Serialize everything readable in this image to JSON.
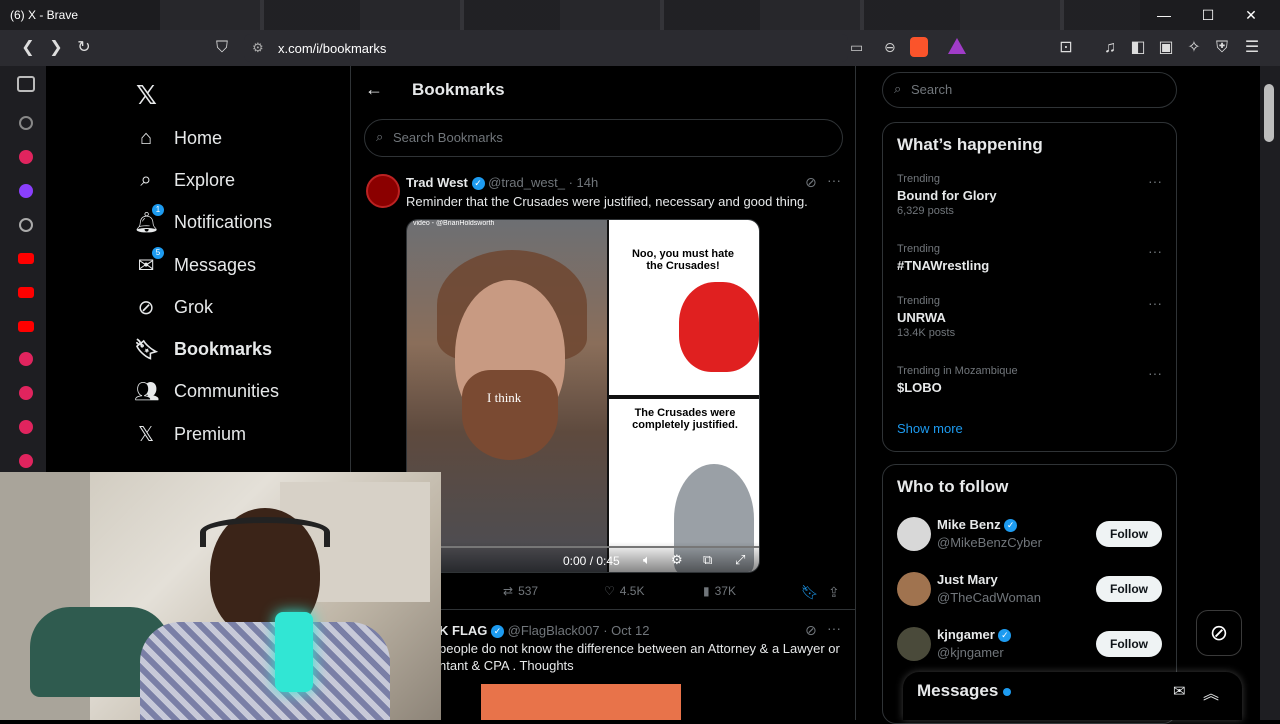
{
  "window": {
    "title": "(6) X - Brave"
  },
  "address_bar": {
    "url": "x.com/i/bookmarks"
  },
  "x_nav": {
    "items": [
      {
        "label": "Home",
        "icon": "home-icon",
        "badge": ""
      },
      {
        "label": "Explore",
        "icon": "search-icon",
        "badge": ""
      },
      {
        "label": "Notifications",
        "icon": "bell-icon",
        "badge": "1"
      },
      {
        "label": "Messages",
        "icon": "mail-icon",
        "badge": "5"
      },
      {
        "label": "Grok",
        "icon": "grok-icon",
        "badge": ""
      },
      {
        "label": "Bookmarks",
        "icon": "bookmark-icon",
        "badge": ""
      },
      {
        "label": "Communities",
        "icon": "communities-icon",
        "badge": ""
      },
      {
        "label": "Premium",
        "icon": "x-logo-icon",
        "badge": ""
      }
    ]
  },
  "main": {
    "title": "Bookmarks",
    "search_placeholder": "Search Bookmarks",
    "tweet1": {
      "name": "Trad West",
      "handle": "@trad_west_",
      "time": "· 14h",
      "text": "Reminder that the Crusades were justified, necessary and good thing.",
      "media": {
        "credit": "video - @BrianHoldsworth",
        "caption": "I think",
        "panel1_text": "Noo, you must hate the Crusades!",
        "panel2_text": "The Crusades were completely justified.",
        "video_time": "0:00 / 0:45"
      },
      "retweets": "537",
      "likes": "4.5K",
      "views": "37K"
    },
    "tweet2": {
      "name": "K FLAG",
      "handle": "@FlagBlack007",
      "time": "· Oct 12",
      "text_line1": "people do not know the difference between an Attorney & a Lawyer or",
      "text_line2": "ntant & CPA . Thoughts"
    }
  },
  "right": {
    "search_placeholder": "Search",
    "happening": {
      "title": "What’s happening",
      "trends": [
        {
          "context": "Trending",
          "name": "Bound for Glory",
          "count": "6,329 posts"
        },
        {
          "context": "Trending",
          "name": "#TNAWrestling",
          "count": ""
        },
        {
          "context": "Trending",
          "name": "UNRWA",
          "count": "13.4K posts"
        },
        {
          "context": "Trending in Mozambique",
          "name": "$LOBO",
          "count": ""
        }
      ],
      "show_more": "Show more"
    },
    "who_to_follow": {
      "title": "Who to follow",
      "accounts": [
        {
          "name": "Mike Benz",
          "handle": "@MikeBenzCyber",
          "button": "Follow"
        },
        {
          "name": "Just Mary",
          "handle": "@TheCadWoman",
          "button": "Follow"
        },
        {
          "name": "kjngamer",
          "handle": "@kjngamer",
          "button": "Follow"
        }
      ]
    }
  },
  "messages_drawer": {
    "title": "Messages"
  }
}
